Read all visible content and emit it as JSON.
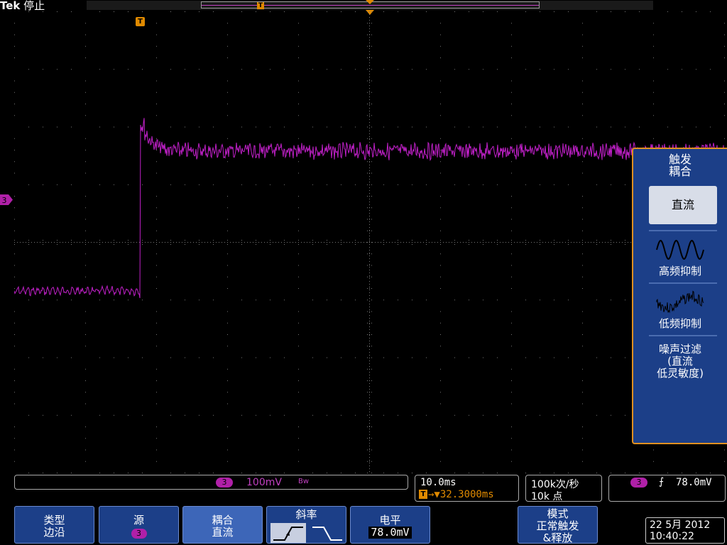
{
  "header": {
    "brand": "Tek",
    "run_state": "停止"
  },
  "waveform": {
    "channel": "3",
    "color": "#c020c8",
    "trigger_marker": "T",
    "channel_marker": "3"
  },
  "side_menu": {
    "title_line1": "触发",
    "title_line2": "耦合",
    "options": [
      {
        "label": "直流",
        "selected": true
      },
      {
        "label": "高频抑制",
        "icon": "sine-wave-icon"
      },
      {
        "label": "低频抑制",
        "icon": "noisy-wave-icon"
      },
      {
        "label_line1": "噪声过滤",
        "label_line2": "(直流",
        "label_line3": "低灵敏度)"
      }
    ]
  },
  "status": {
    "ch3_badge": "3",
    "ch3_scale": "100mV",
    "ch3_bw": "Bw",
    "horizontal_scale": "10.0ms",
    "horizontal_position_marker": "T",
    "horizontal_position": "→▼32.3000ms",
    "sample_rate": "100k次/秒",
    "record_length": "10k 点",
    "trigger_source_badge": "3",
    "trigger_slope_symbol": "⨍",
    "trigger_level": "78.0mV"
  },
  "buttons": {
    "type_label": "类型",
    "type_value": "边沿",
    "source_label": "源",
    "source_value": "3",
    "coupling_label": "耦合",
    "coupling_value": "直流",
    "slope_label": "斜率",
    "level_label": "电平",
    "level_value": "78.0mV",
    "mode_label": "模式",
    "mode_value_line1": "正常触发",
    "mode_value_line2": "&释放"
  },
  "datetime": {
    "date": "22 5月 2012",
    "time": "10:40:22"
  }
}
